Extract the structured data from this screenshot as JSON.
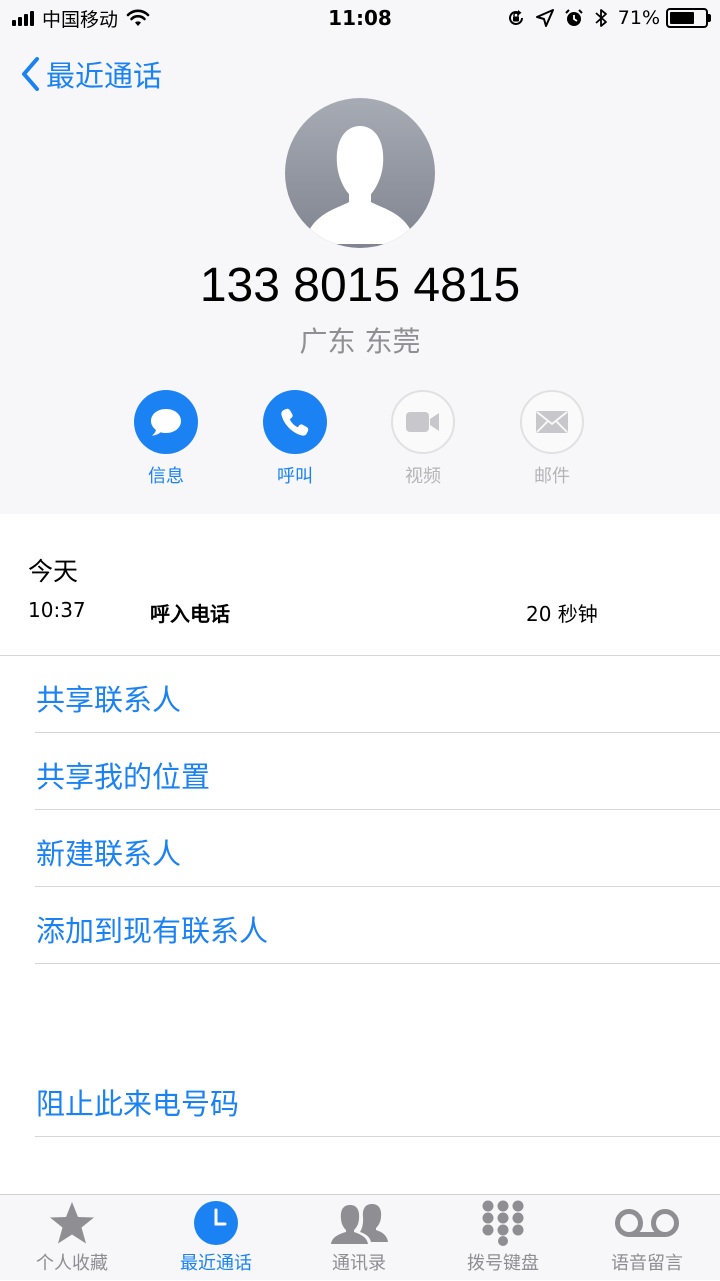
{
  "status_bar": {
    "carrier": "中国移动",
    "time": "11:08",
    "battery": "71%",
    "battery_level": 0.71
  },
  "nav": {
    "back_label": "最近通话"
  },
  "contact": {
    "phone_number": "133 8015 4815",
    "location": "广东 东莞",
    "avatar_icon": "person-silhouette-icon"
  },
  "actions": [
    {
      "label": "信息",
      "icon": "message-bubble-icon",
      "enabled": true
    },
    {
      "label": "呼叫",
      "icon": "phone-icon",
      "enabled": true
    },
    {
      "label": "视频",
      "icon": "video-camera-icon",
      "enabled": false
    },
    {
      "label": "邮件",
      "icon": "envelope-icon",
      "enabled": false
    }
  ],
  "call_log": {
    "day": "今天",
    "entries": [
      {
        "time": "10:37",
        "type": "呼入电话",
        "duration": "20 秒钟"
      }
    ]
  },
  "options": {
    "share_contact": "共享联系人",
    "share_location": "共享我的位置",
    "new_contact": "新建联系人",
    "add_to_existing": "添加到现有联系人",
    "block_caller": "阻止此来电号码"
  },
  "tab_bar": {
    "tabs": [
      {
        "label": "个人收藏",
        "icon": "star-icon",
        "active": false
      },
      {
        "label": "最近通话",
        "icon": "clock-icon",
        "active": true
      },
      {
        "label": "通讯录",
        "icon": "contacts-icon",
        "active": false
      },
      {
        "label": "拨号键盘",
        "icon": "keypad-icon",
        "active": false
      },
      {
        "label": "语音留言",
        "icon": "voicemail-icon",
        "active": false
      }
    ]
  },
  "colors": {
    "accent": "#1a82f2",
    "header_background": "#f7f7f9",
    "secondary_text": "#8e8e93",
    "disabled": "#b4b4b9"
  }
}
